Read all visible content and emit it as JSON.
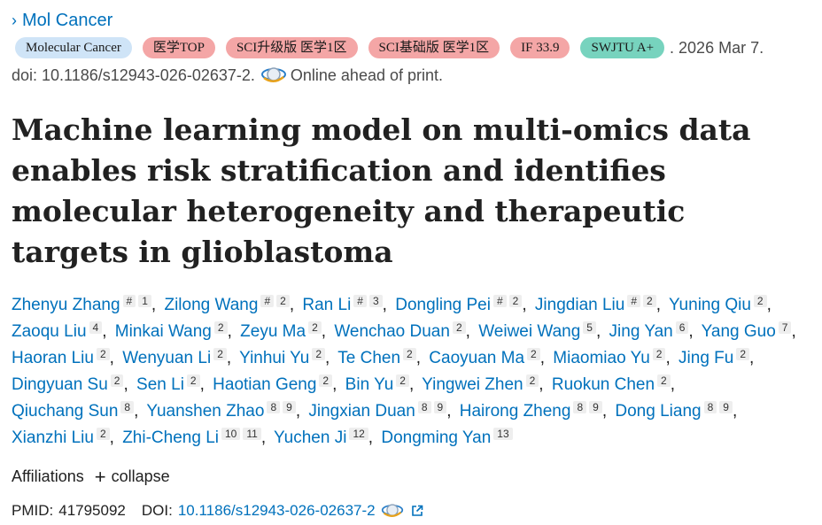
{
  "journal": {
    "chevron": "›",
    "name": "Mol Cancer"
  },
  "badges": [
    {
      "label": "Molecular Cancer",
      "color": "#cfe4f7"
    },
    {
      "label": "医学TOP",
      "color": "#f4a6a6"
    },
    {
      "label": "SCI升级版 医学1区",
      "color": "#f4a6a6"
    },
    {
      "label": "SCI基础版 医学1区",
      "color": "#f4a6a6"
    },
    {
      "label": "IF 33.9",
      "color": "#f4a6a6"
    },
    {
      "label": "SWJTU A+",
      "color": "#77d3be"
    }
  ],
  "pub_date": ". 2026 Mar 7.",
  "doi_line": "doi: 10.1186/s12943-026-02637-2.",
  "online_status": "Online ahead of print.",
  "title": "Machine learning model on multi-omics data enables risk stratification and identifies molecular heterogeneity and therapeutic targets in glioblastoma",
  "authors": [
    {
      "name": "Zhenyu Zhang",
      "sup": [
        "#",
        "1"
      ]
    },
    {
      "name": "Zilong Wang",
      "sup": [
        "#",
        "2"
      ]
    },
    {
      "name": "Ran Li",
      "sup": [
        "#",
        "3"
      ]
    },
    {
      "name": "Dongling Pei",
      "sup": [
        "#",
        "2"
      ]
    },
    {
      "name": "Jingdian Liu",
      "sup": [
        "#",
        "2"
      ]
    },
    {
      "name": "Yuning Qiu",
      "sup": [
        "2"
      ]
    },
    {
      "name": "Zaoqu Liu",
      "sup": [
        "4"
      ]
    },
    {
      "name": "Minkai Wang",
      "sup": [
        "2"
      ]
    },
    {
      "name": "Zeyu Ma",
      "sup": [
        "2"
      ]
    },
    {
      "name": "Wenchao Duan",
      "sup": [
        "2"
      ]
    },
    {
      "name": "Weiwei Wang",
      "sup": [
        "5"
      ]
    },
    {
      "name": "Jing Yan",
      "sup": [
        "6"
      ]
    },
    {
      "name": "Yang Guo",
      "sup": [
        "7"
      ]
    },
    {
      "name": "Haoran Liu",
      "sup": [
        "2"
      ]
    },
    {
      "name": "Wenyuan Li",
      "sup": [
        "2"
      ]
    },
    {
      "name": "Yinhui Yu",
      "sup": [
        "2"
      ]
    },
    {
      "name": "Te Chen",
      "sup": [
        "2"
      ]
    },
    {
      "name": "Caoyuan Ma",
      "sup": [
        "2"
      ]
    },
    {
      "name": "Miaomiao Yu",
      "sup": [
        "2"
      ]
    },
    {
      "name": "Jing Fu",
      "sup": [
        "2"
      ]
    },
    {
      "name": "Dingyuan Su",
      "sup": [
        "2"
      ]
    },
    {
      "name": "Sen Li",
      "sup": [
        "2"
      ]
    },
    {
      "name": "Haotian Geng",
      "sup": [
        "2"
      ]
    },
    {
      "name": "Bin Yu",
      "sup": [
        "2"
      ]
    },
    {
      "name": "Yingwei Zhen",
      "sup": [
        "2"
      ]
    },
    {
      "name": "Ruokun Chen",
      "sup": [
        "2"
      ]
    },
    {
      "name": "Qiuchang Sun",
      "sup": [
        "8"
      ]
    },
    {
      "name": "Yuanshen Zhao",
      "sup": [
        "8",
        "9"
      ]
    },
    {
      "name": "Jingxian Duan",
      "sup": [
        "8",
        "9"
      ]
    },
    {
      "name": "Hairong Zheng",
      "sup": [
        "8",
        "9"
      ]
    },
    {
      "name": "Dong Liang",
      "sup": [
        "8",
        "9"
      ]
    },
    {
      "name": "Xianzhi Liu",
      "sup": [
        "2"
      ]
    },
    {
      "name": "Zhi-Cheng Li",
      "sup": [
        "10",
        "11"
      ]
    },
    {
      "name": "Yuchen Ji",
      "sup": [
        "12"
      ]
    },
    {
      "name": "Dongming Yan",
      "sup": [
        "13"
      ]
    }
  ],
  "affiliations": {
    "label": "Affiliations",
    "plus": "+",
    "toggle": "collapse"
  },
  "ids": {
    "pmid_label": "PMID:",
    "pmid": "41795092",
    "doi_label": "DOI:",
    "doi": "10.1186/s12943-026-02637-2"
  },
  "icons": {
    "publisher": "publisher-globe-icon",
    "external": "external-link-icon"
  }
}
